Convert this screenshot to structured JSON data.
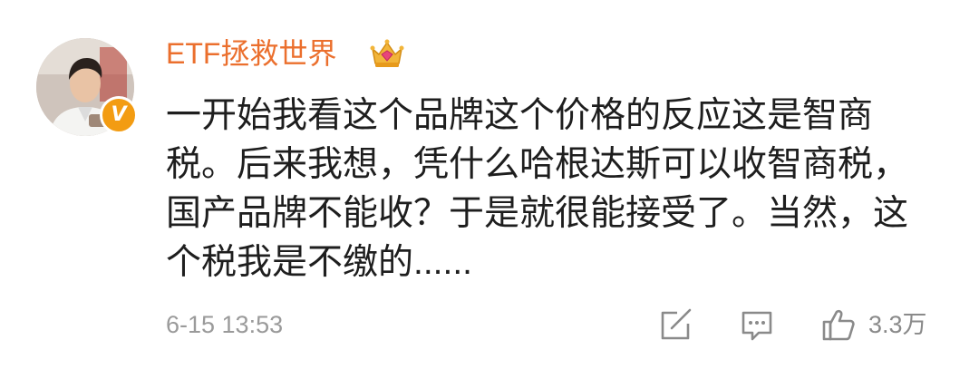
{
  "comment": {
    "author": {
      "name": "ETF拯救世界",
      "name_color": "#eb6f2d",
      "avatar_icon": "user-avatar",
      "verified_badge_letter": "V",
      "verified_badge_color": "#f39c12",
      "member_icon": "crown-icon"
    },
    "lines": [
      "一开始我看这个品牌这个价格的反应这是智商",
      "税。后来我想，凭什么哈根达斯可以收智商税，",
      "国产品牌不能收？于是就很能接受了。当然，这",
      "个税我是不缴的......"
    ],
    "timestamp": "6-15 13:53",
    "actions": {
      "share_icon": "share-icon",
      "comment_icon": "comment-icon",
      "like_icon": "thumbs-up-icon",
      "like_count": "3.3万",
      "icon_color": "#8a8a8a"
    }
  }
}
